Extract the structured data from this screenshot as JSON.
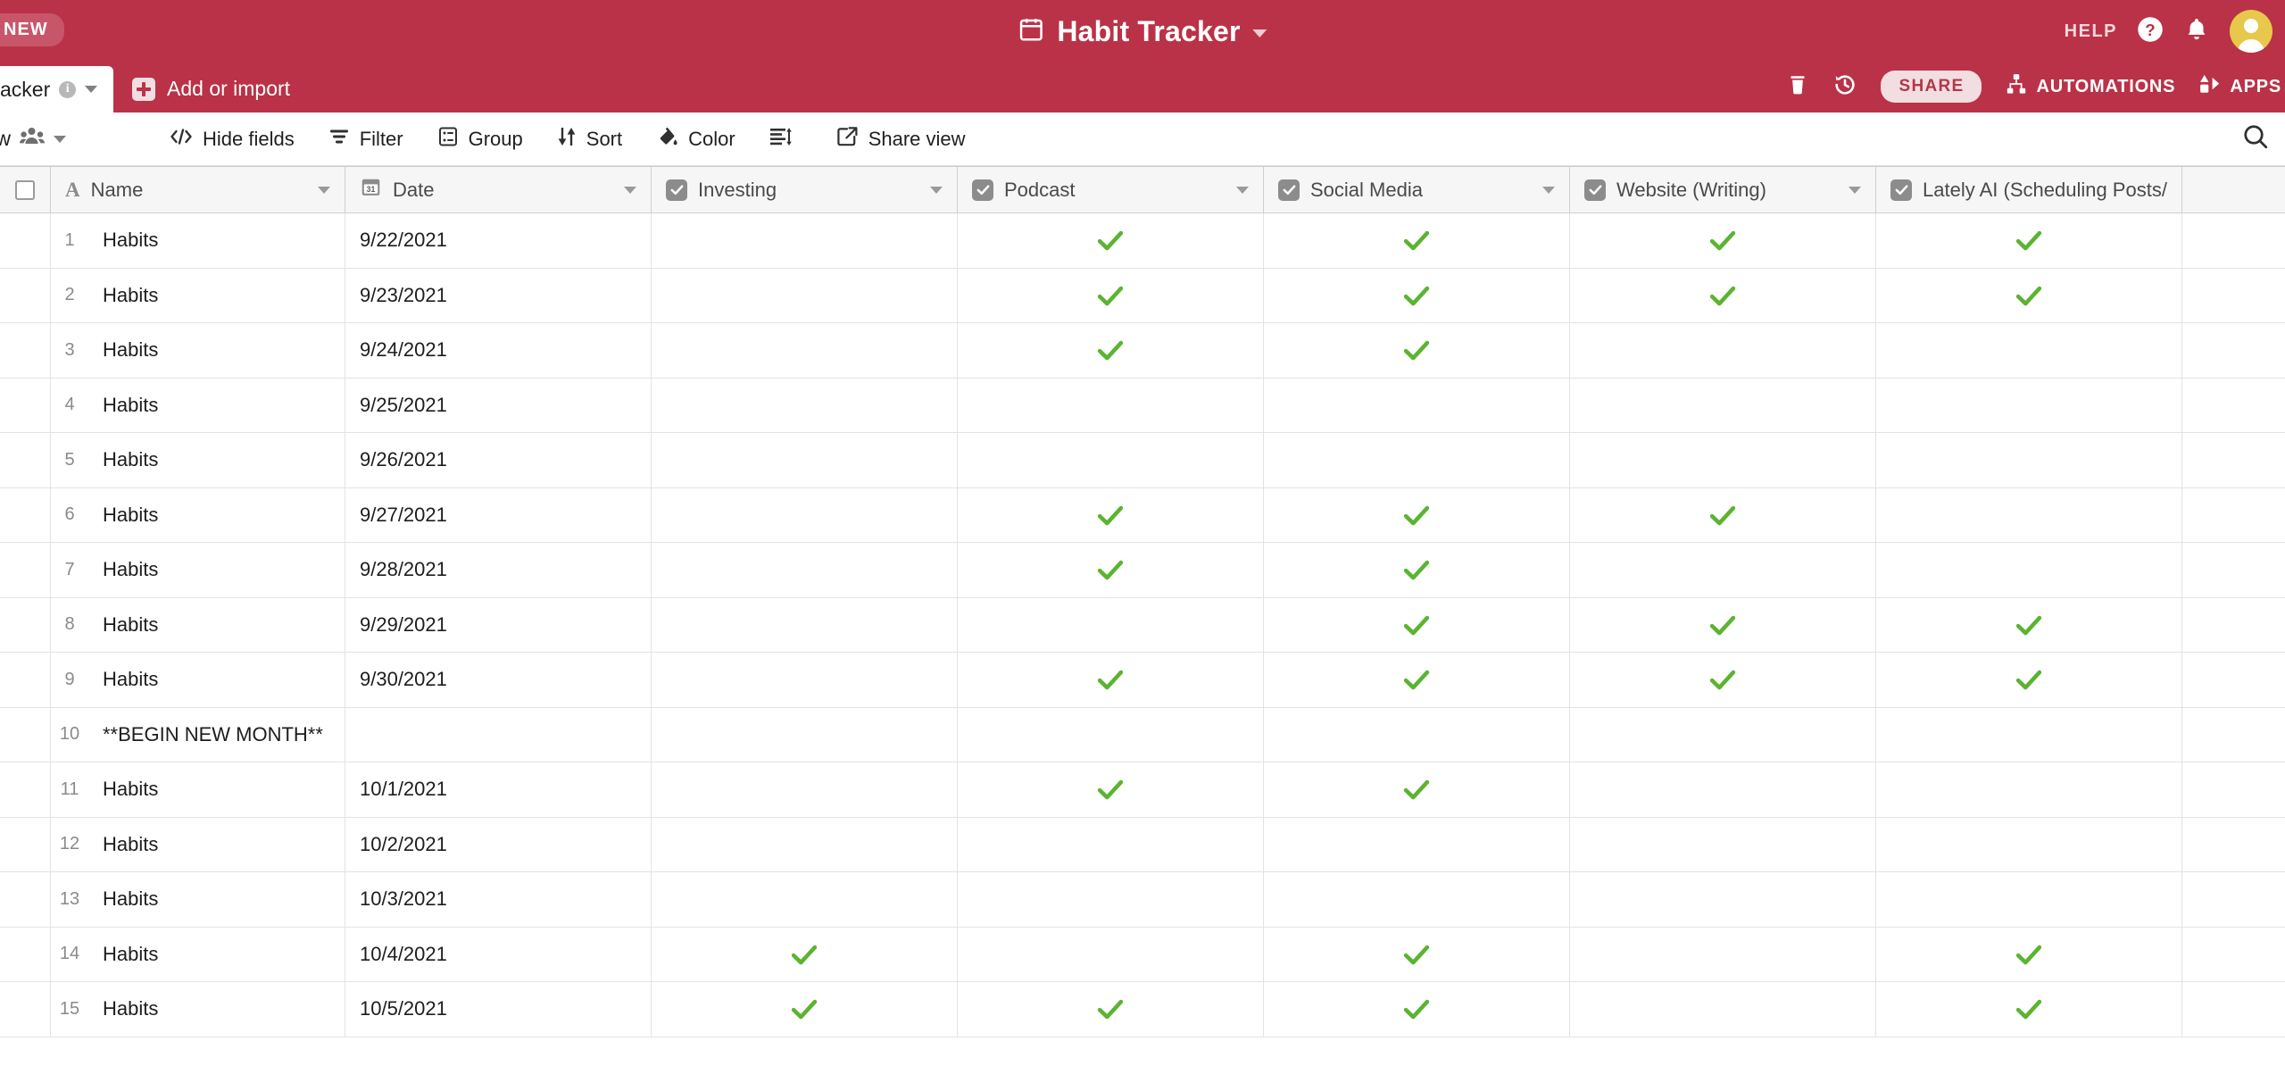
{
  "brand": {
    "new_badge": "NEW",
    "title": "Habit Tracker",
    "title_dropdown_icon": "chevron-down-icon",
    "calendar_icon": "calendar-icon",
    "help_label": "HELP",
    "help_icon": "question-circle-icon",
    "notifications_icon": "bell-icon",
    "avatar_icon": "user-avatar",
    "bar_color": "#ba3247",
    "avatar_color": "#e8c84b"
  },
  "tabbar": {
    "table_tab_label": "acker",
    "table_tab_info_icon": "info-icon",
    "table_tab_caret_icon": "chevron-down-icon",
    "add_import_label": "Add or import",
    "add_import_icon": "plus-square-icon",
    "trash_icon": "trash-icon",
    "history_icon": "history-icon",
    "share_label": "SHARE",
    "automations_label": "AUTOMATIONS",
    "automations_icon": "automations-icon",
    "apps_label": "APPS",
    "apps_icon": "apps-icon"
  },
  "viewbar": {
    "view_name": "view",
    "collaborators_icon": "people-icon",
    "view_caret_icon": "chevron-down-icon",
    "buttons": [
      {
        "label": "Hide fields",
        "icon": "hide-fields-icon"
      },
      {
        "label": "Filter",
        "icon": "filter-icon"
      },
      {
        "label": "Group",
        "icon": "group-icon"
      },
      {
        "label": "Sort",
        "icon": "sort-icon"
      },
      {
        "label": "Color",
        "icon": "paint-bucket-icon"
      },
      {
        "label": "",
        "icon": "row-height-icon"
      },
      {
        "label": "Share view",
        "icon": "share-view-icon"
      }
    ],
    "search_icon": "search-icon"
  },
  "grid": {
    "select_all_icon": "checkbox-unchecked-icon",
    "columns": [
      {
        "label": "Name",
        "field_icon": "text-field-icon",
        "type": "text"
      },
      {
        "label": "Date",
        "field_icon": "calendar-field-icon",
        "type": "date"
      },
      {
        "label": "Investing",
        "field_icon": "checkbox-field-icon",
        "type": "checkbox"
      },
      {
        "label": "Podcast",
        "field_icon": "checkbox-field-icon",
        "type": "checkbox"
      },
      {
        "label": "Social Media",
        "field_icon": "checkbox-field-icon",
        "type": "checkbox"
      },
      {
        "label": "Website (Writing)",
        "field_icon": "checkbox-field-icon",
        "type": "checkbox"
      },
      {
        "label": "Lately AI (Scheduling Posts/M",
        "field_icon": "checkbox-field-icon",
        "type": "checkbox"
      }
    ],
    "check_color": "#5bb431",
    "rows": [
      {
        "num": "1",
        "name": "Habits",
        "date": "9/22/2021",
        "investing": false,
        "podcast": true,
        "social": true,
        "website": true,
        "lately": true
      },
      {
        "num": "2",
        "name": "Habits",
        "date": "9/23/2021",
        "investing": false,
        "podcast": true,
        "social": true,
        "website": true,
        "lately": true
      },
      {
        "num": "3",
        "name": "Habits",
        "date": "9/24/2021",
        "investing": false,
        "podcast": true,
        "social": true,
        "website": false,
        "lately": false
      },
      {
        "num": "4",
        "name": "Habits",
        "date": "9/25/2021",
        "investing": false,
        "podcast": false,
        "social": false,
        "website": false,
        "lately": false
      },
      {
        "num": "5",
        "name": "Habits",
        "date": "9/26/2021",
        "investing": false,
        "podcast": false,
        "social": false,
        "website": false,
        "lately": false
      },
      {
        "num": "6",
        "name": "Habits",
        "date": "9/27/2021",
        "investing": false,
        "podcast": true,
        "social": true,
        "website": true,
        "lately": false
      },
      {
        "num": "7",
        "name": "Habits",
        "date": "9/28/2021",
        "investing": false,
        "podcast": true,
        "social": true,
        "website": false,
        "lately": false
      },
      {
        "num": "8",
        "name": "Habits",
        "date": "9/29/2021",
        "investing": false,
        "podcast": false,
        "social": true,
        "website": true,
        "lately": true
      },
      {
        "num": "9",
        "name": "Habits",
        "date": "9/30/2021",
        "investing": false,
        "podcast": true,
        "social": true,
        "website": true,
        "lately": true
      },
      {
        "num": "10",
        "name": "**BEGIN NEW MONTH**",
        "date": "",
        "investing": false,
        "podcast": false,
        "social": false,
        "website": false,
        "lately": false
      },
      {
        "num": "11",
        "name": "Habits",
        "date": "10/1/2021",
        "investing": false,
        "podcast": true,
        "social": true,
        "website": false,
        "lately": false
      },
      {
        "num": "12",
        "name": "Habits",
        "date": "10/2/2021",
        "investing": false,
        "podcast": false,
        "social": false,
        "website": false,
        "lately": false
      },
      {
        "num": "13",
        "name": "Habits",
        "date": "10/3/2021",
        "investing": false,
        "podcast": false,
        "social": false,
        "website": false,
        "lately": false
      },
      {
        "num": "14",
        "name": "Habits",
        "date": "10/4/2021",
        "investing": true,
        "podcast": false,
        "social": true,
        "website": false,
        "lately": true
      },
      {
        "num": "15",
        "name": "Habits",
        "date": "10/5/2021",
        "investing": true,
        "podcast": true,
        "social": true,
        "website": false,
        "lately": true
      }
    ]
  }
}
